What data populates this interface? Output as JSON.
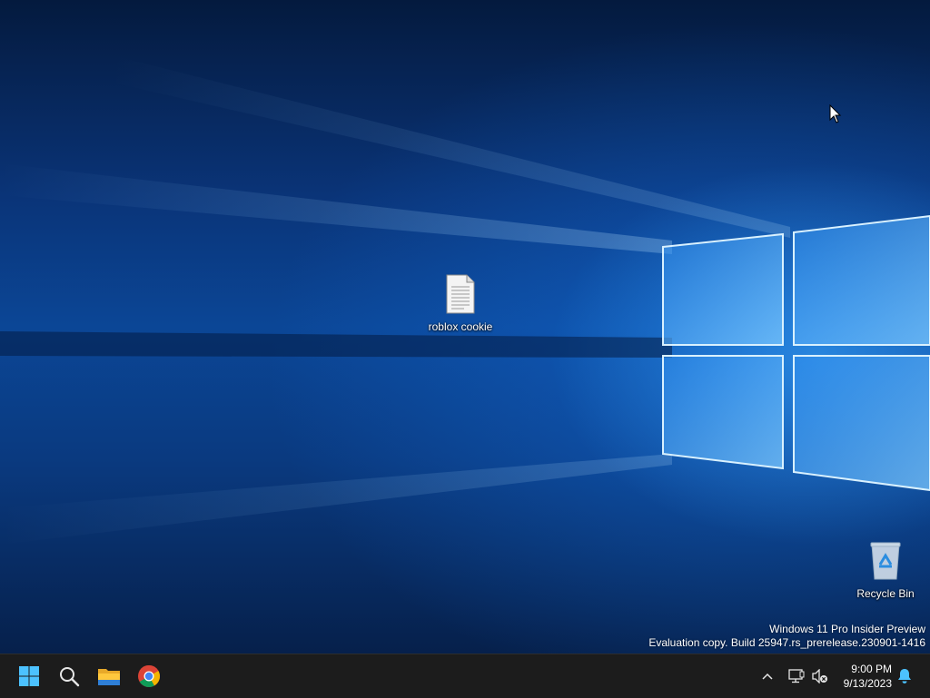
{
  "desktop": {
    "icons": [
      {
        "label": "roblox cookie",
        "icon": "text-document-icon"
      },
      {
        "label": "Recycle Bin",
        "icon": "recycle-bin-icon"
      }
    ],
    "watermark": {
      "line1": "Windows 11 Pro Insider Preview",
      "line2": "Evaluation copy. Build 25947.rs_prerelease.230901-1416"
    }
  },
  "taskbar": {
    "pinned": [
      {
        "name": "start",
        "icon": "windows-logo-icon"
      },
      {
        "name": "search",
        "icon": "search-icon"
      },
      {
        "name": "file-explorer",
        "icon": "folder-icon"
      },
      {
        "name": "chrome",
        "icon": "chrome-icon"
      }
    ],
    "tray": {
      "icons": [
        "chevron-up-icon",
        "network-icon",
        "volume-muted-icon",
        "notification-bell-icon"
      ],
      "time": "9:00 PM",
      "date": "9/13/2023"
    }
  },
  "colors": {
    "taskbar": "#1c1c1c",
    "accent": "#3aa0ff"
  }
}
